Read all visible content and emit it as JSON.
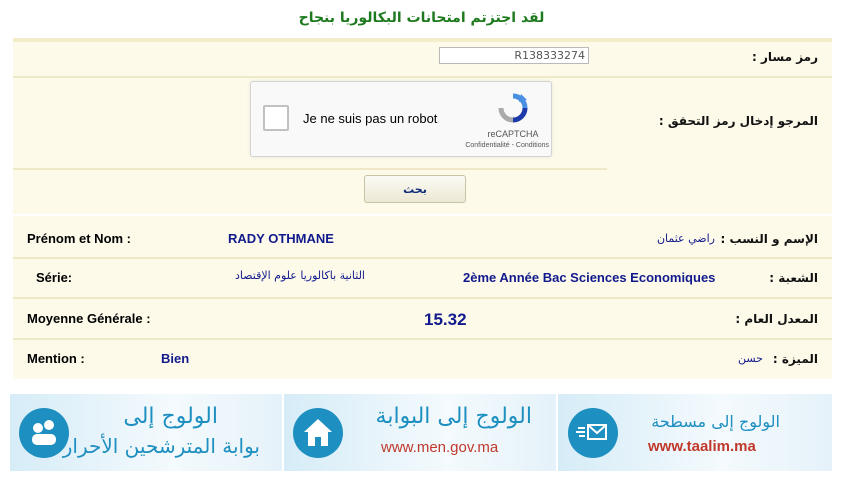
{
  "header": {
    "title": "لقد اجتزتم امتحانات البكالوريا بنجاح"
  },
  "form": {
    "massar_label": "رمز مسار :",
    "massar_value": "R138333274",
    "captcha_label": "المرجو إدخال رمز التحقق :",
    "recaptcha": {
      "checkbox_label": "Je ne suis pas un robot",
      "brand": "reCAPTCHA",
      "links": "Confidentialité - Conditions"
    },
    "search_button": "بحث"
  },
  "results": {
    "name": {
      "label_fr": "Prénom et Nom :",
      "value_fr": "RADY OTHMANE",
      "value_ar": "راضي عثمان",
      "label_ar": "الإسم و النسب :"
    },
    "serie": {
      "label_fr": "Série:",
      "value_ar": "الثانية باكالوريا علوم الإقتصاد",
      "value_fr": "2ème Année Bac Sciences Economiques",
      "label_ar": "الشعبة :"
    },
    "average": {
      "label_fr": "Moyenne Générale :",
      "value": "15.32",
      "label_ar": "المعدل العام :"
    },
    "mention": {
      "label_fr": "Mention :",
      "value_fr": "Bien",
      "value_ar": "حسن",
      "label_ar": "الميزة :"
    }
  },
  "banners": [
    {
      "title": "الولوج إلى",
      "subtitle": "بوابة المترشحين الأحرار",
      "icon": "candidates-portal-icon"
    },
    {
      "title": "الولوج إلى البوابة",
      "subtitle": "www.men.gov.ma",
      "icon": "home-icon"
    },
    {
      "title": "الولوج إلى مسطحة",
      "subtitle": "www.taalim.ma",
      "icon": "taalim-icon"
    }
  ],
  "colors": {
    "accent": "#1d8fc0",
    "panel": "#fdfaea",
    "value_text": "#111a8c",
    "headline": "#1e7a1e"
  }
}
